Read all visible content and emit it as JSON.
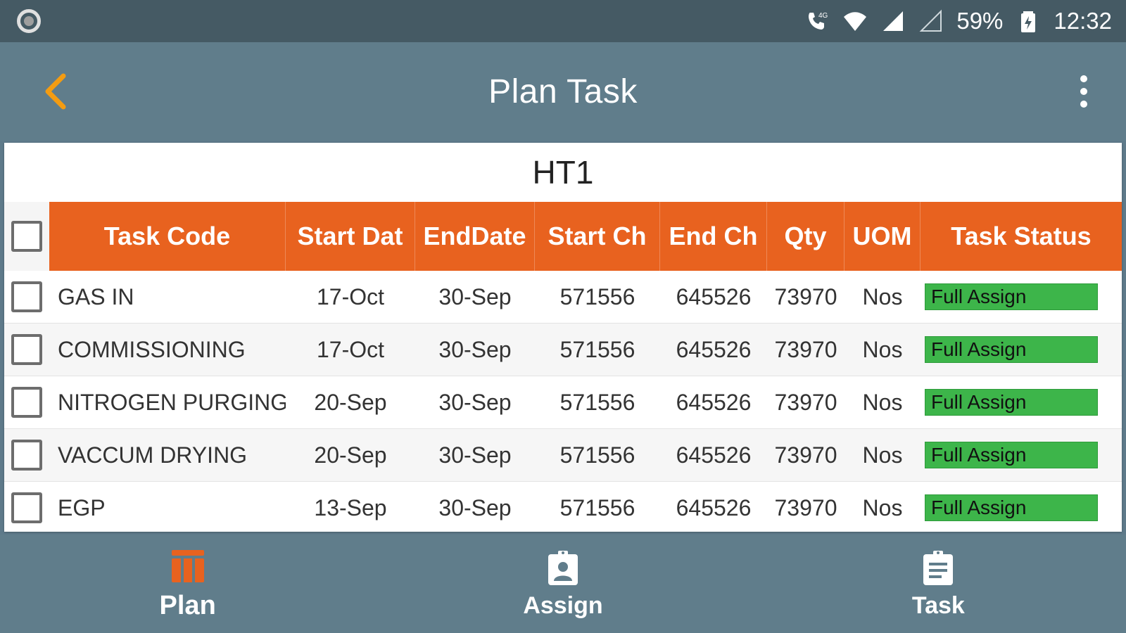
{
  "status_bar": {
    "network_label": "4G",
    "battery_percent": "59%",
    "time": "12:32"
  },
  "app_bar": {
    "title": "Plan Task",
    "back_icon": "chevron-left-icon",
    "menu_icon": "more-vert-icon"
  },
  "card": {
    "title": "HT1"
  },
  "table": {
    "headers": {
      "task_code": "Task Code",
      "start_date": "Start Dat",
      "end_date": "EndDate",
      "start_ch": "Start  Ch",
      "end_ch": "End Ch",
      "qty": "Qty",
      "uom": "UOM",
      "task_status": "Task Status"
    },
    "rows": [
      {
        "task_code": "GAS IN",
        "start_date": "17-Oct",
        "end_date": "30-Sep",
        "start_ch": "571556",
        "end_ch": "645526",
        "qty": "73970",
        "uom": "Nos",
        "status": "Full Assign"
      },
      {
        "task_code": "COMMISSIONING",
        "start_date": "17-Oct",
        "end_date": "30-Sep",
        "start_ch": "571556",
        "end_ch": "645526",
        "qty": "73970",
        "uom": "Nos",
        "status": "Full Assign"
      },
      {
        "task_code": "NITROGEN PURGING",
        "start_date": "20-Sep",
        "end_date": "30-Sep",
        "start_ch": "571556",
        "end_ch": "645526",
        "qty": "73970",
        "uom": "Nos",
        "status": "Full Assign"
      },
      {
        "task_code": "VACCUM DRYING",
        "start_date": "20-Sep",
        "end_date": "30-Sep",
        "start_ch": "571556",
        "end_ch": "645526",
        "qty": "73970",
        "uom": "Nos",
        "status": "Full Assign"
      },
      {
        "task_code": "EGP",
        "start_date": "13-Sep",
        "end_date": "30-Sep",
        "start_ch": "571556",
        "end_ch": "645526",
        "qty": "73970",
        "uom": "Nos",
        "status": "Full Assign"
      }
    ]
  },
  "bottom_nav": {
    "items": [
      {
        "label": "Plan",
        "icon": "plan-icon",
        "active": true
      },
      {
        "label": "Assign",
        "icon": "assign-icon",
        "active": false
      },
      {
        "label": "Task",
        "icon": "task-icon",
        "active": false
      }
    ]
  },
  "colors": {
    "status_bar": "#455a64",
    "app_bar": "#607d8b",
    "accent_orange": "#e8621f",
    "back_arrow": "#f39c12",
    "status_green": "#3db54a"
  }
}
